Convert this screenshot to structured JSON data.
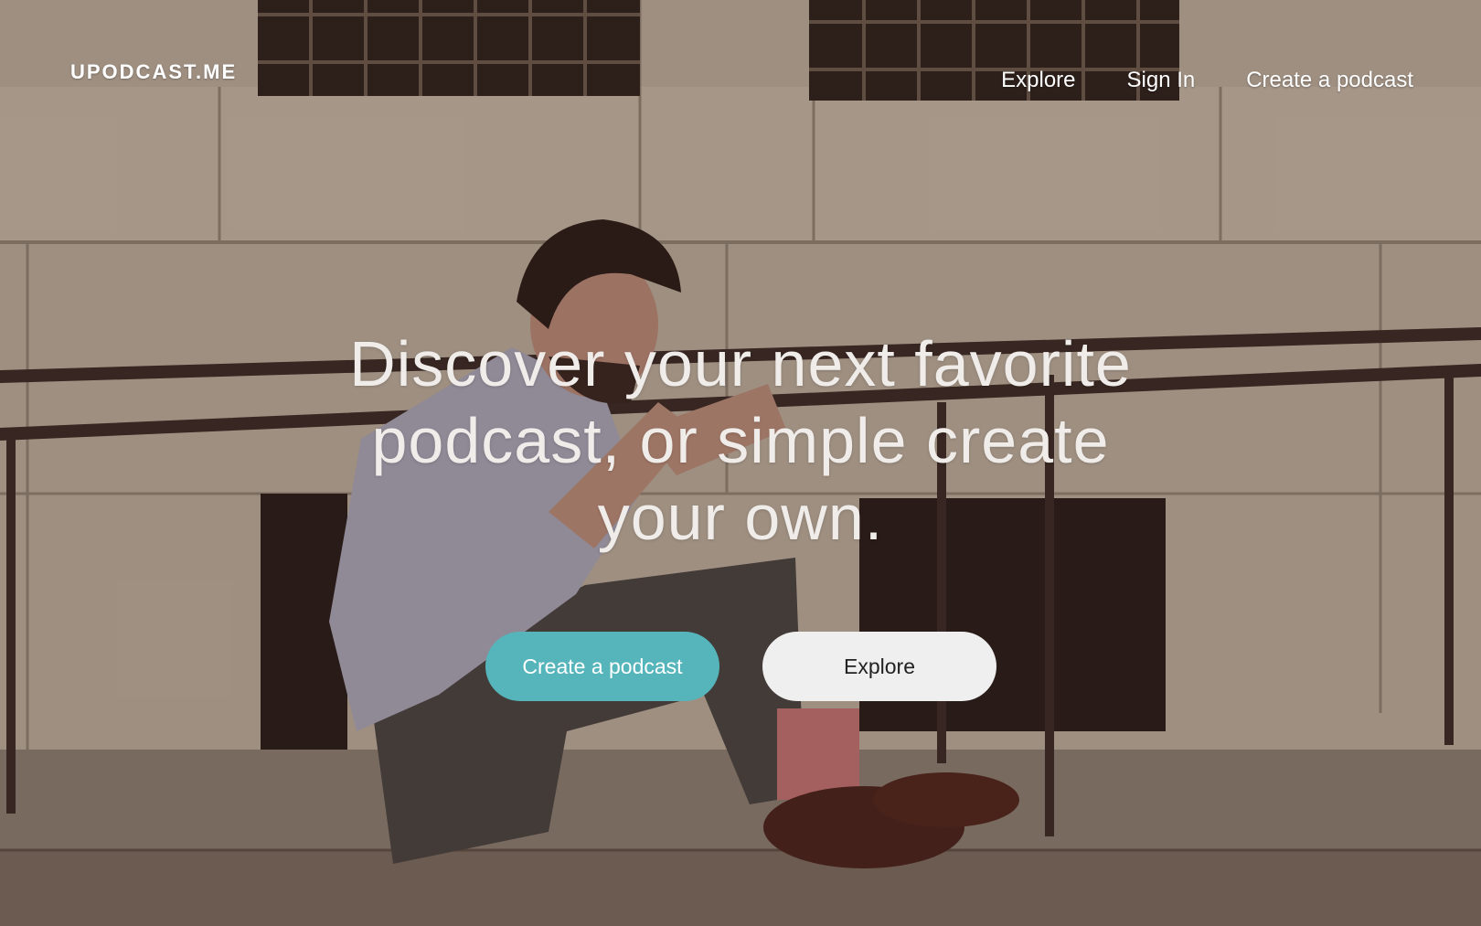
{
  "brand": {
    "logo_text": "UPODCAST.ME"
  },
  "nav": {
    "items": [
      {
        "label": "Explore"
      },
      {
        "label": "Sign In"
      },
      {
        "label": "Create a podcast"
      }
    ]
  },
  "hero": {
    "headline": "Discover your next favorite podcast, or simple create your own.",
    "primary_button": "Create a podcast",
    "secondary_button": "Explore"
  },
  "colors": {
    "accent": "#55b5bb",
    "secondary_button_bg": "#efefef",
    "text_light": "#ffffff"
  }
}
